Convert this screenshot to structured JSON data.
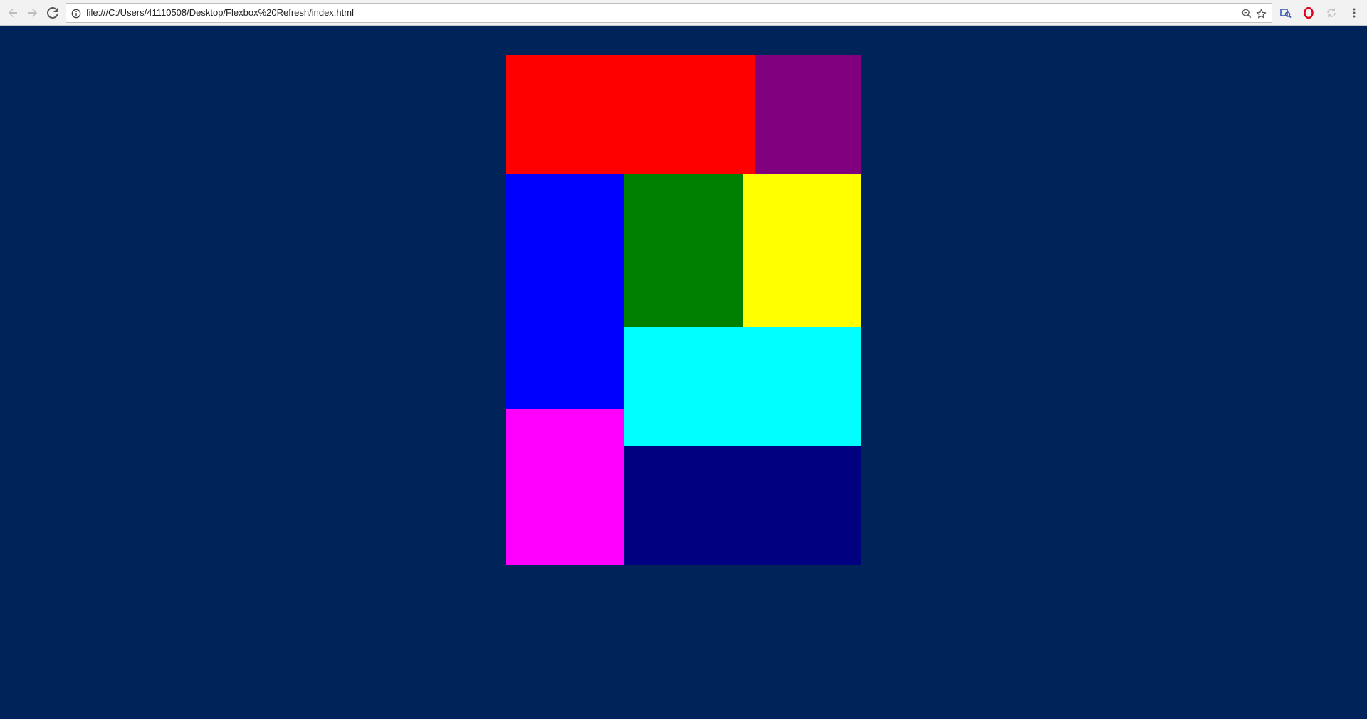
{
  "browser": {
    "url": "file:///C:/Users/41110508/Desktop/Flexbox%20Refresh/index.html",
    "icons": {
      "back": "arrow-left-icon",
      "forward": "arrow-right-icon",
      "reload": "reload-icon",
      "info": "info-icon",
      "zoom": "zoom-out-icon",
      "bookmark": "star-icon",
      "ext1": "extension-icon",
      "ext2": "opera-icon",
      "ext3": "sync-icon",
      "menu": "kebab-menu-icon"
    }
  },
  "page": {
    "background": "#00235a",
    "boxes": [
      {
        "name": "red-box",
        "color": "#ff0000"
      },
      {
        "name": "purple-box",
        "color": "#800080"
      },
      {
        "name": "blue-box",
        "color": "#0000ff"
      },
      {
        "name": "green-box",
        "color": "#008000"
      },
      {
        "name": "yellow-box",
        "color": "#ffff00"
      },
      {
        "name": "cyan-box",
        "color": "#00ffff"
      },
      {
        "name": "magenta-box",
        "color": "#ff00ff"
      },
      {
        "name": "navy-box",
        "color": "#000080"
      }
    ]
  }
}
